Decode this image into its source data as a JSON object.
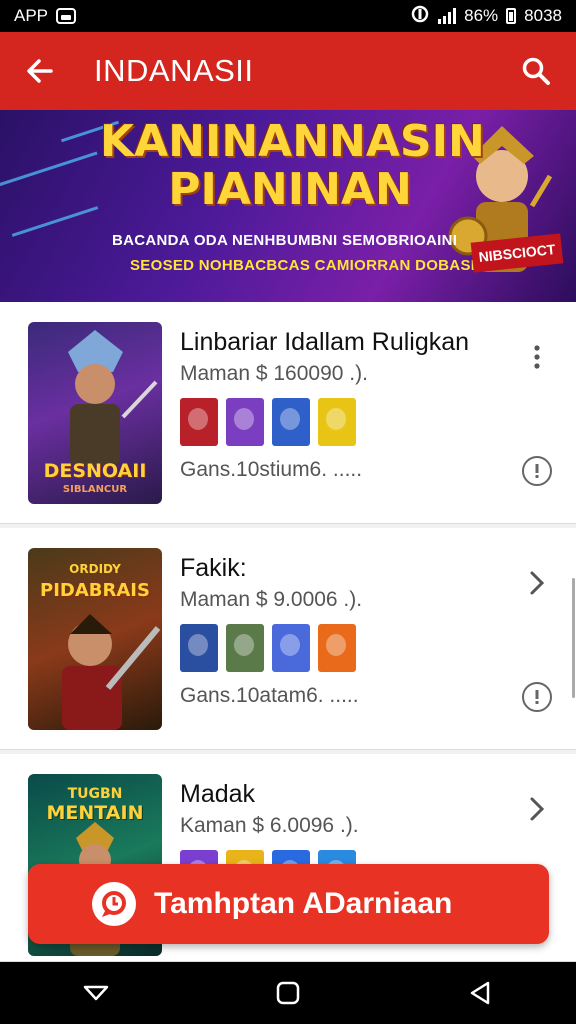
{
  "status_bar": {
    "app_label": "APP",
    "battery_percent": "86%",
    "time": "8038"
  },
  "app_bar": {
    "title": "INDANASII"
  },
  "banner": {
    "title_line1": "KANINANNASIN",
    "title_line2": "PIANINAN",
    "subtitle_line1": "BACANDA ODA NENHBUMBNI SEMOBRIOAINI",
    "subtitle_line2": "SEOSED NOHBACBCAS CAMIORRAN DOBASIUN",
    "ribbon_text": "NIBSCIOCT"
  },
  "cards": [
    {
      "title": "Linbariar Idallam Ruligkan",
      "price": "Maman $ 160090 .).",
      "meta": "Gans.10stium6. .....",
      "thumb_label_line1": "DESNOAII",
      "thumb_label_line2": "SIBLANCUR",
      "action_icon": "more-vert-icon",
      "mini_colors": [
        "#b8212a",
        "#7b3ec0",
        "#2f5fc8",
        "#e8c415"
      ]
    },
    {
      "title": "Fakik:",
      "price": "Maman $ 9.0006 .).",
      "meta": "Gans.10atam6. .....",
      "thumb_label_line1": "ORDIDY",
      "thumb_label_line2": "PIDABRAIS",
      "action_icon": "chevron-right-icon",
      "mini_colors": [
        "#2a4ea0",
        "#5b7a4a",
        "#4a6adc",
        "#e86a1a"
      ]
    },
    {
      "title": "Madak",
      "price": "Kaman $ 6.0096 .).",
      "meta": "",
      "thumb_label_line1": "TUGBN",
      "thumb_label_line2": "MENTAIN",
      "action_icon": "chevron-right-icon",
      "mini_colors": [
        "#7a3fd0",
        "#e8b41a",
        "#2a6ae0",
        "#2a8ae0"
      ]
    }
  ],
  "fab": {
    "label": "Tamhptan ADarniaan"
  }
}
